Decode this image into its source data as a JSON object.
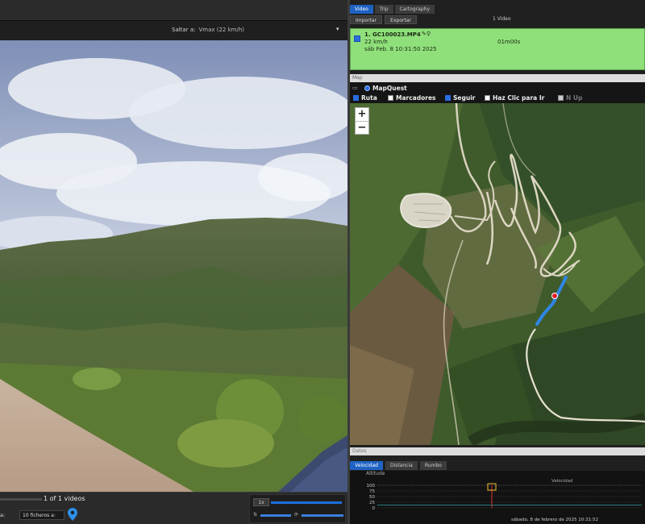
{
  "left": {
    "jump_label": "Saltar a:",
    "jump_value": "Vmax (22 km/h)",
    "videos_count": "1 of 1 videos",
    "files_label": "a:",
    "files_select": "10 ficheros a:",
    "ctrl_button": "1x"
  },
  "right": {
    "tabs": [
      "Video",
      "Trip",
      "Cartography"
    ],
    "actions": [
      "Importar",
      "Exportar"
    ],
    "video_count": "1 Video",
    "video": {
      "name": "1. GC100023.MP4",
      "speed": "22 km/h",
      "date": "sáb Feb. 8 10:31:50 2025",
      "duration": "01m00s"
    },
    "map_header": "Map",
    "map_provider": "MapQuest",
    "options": [
      {
        "label": "Ruta",
        "checked": true
      },
      {
        "label": "Marcadores",
        "checked": false
      },
      {
        "label": "Seguir",
        "checked": true
      },
      {
        "label": "Haz Clic para Ir",
        "checked": false
      },
      {
        "label": "N Up",
        "checked": false
      }
    ],
    "zoom_in": "+",
    "zoom_out": "−",
    "datos_header": "Datos",
    "chart_tabs": [
      "Velocidad",
      "Distancia",
      "Rumbo"
    ],
    "chart_caption": "sábado, 8 de febrero de 2025 10:31:52"
  },
  "colors": {
    "accent": "#1e63c4",
    "selected_row": "#8fe07a",
    "route": "#2f86e8",
    "marker": "#e0202a"
  },
  "chart_data": {
    "type": "line",
    "title": "",
    "series_label_top": "Altitude",
    "series_label_right": "Velocidad",
    "ylabel": "",
    "y_ticks": [
      100,
      75,
      50,
      25,
      0
    ],
    "ylim": [
      0,
      100
    ],
    "marker_value": 100
  }
}
